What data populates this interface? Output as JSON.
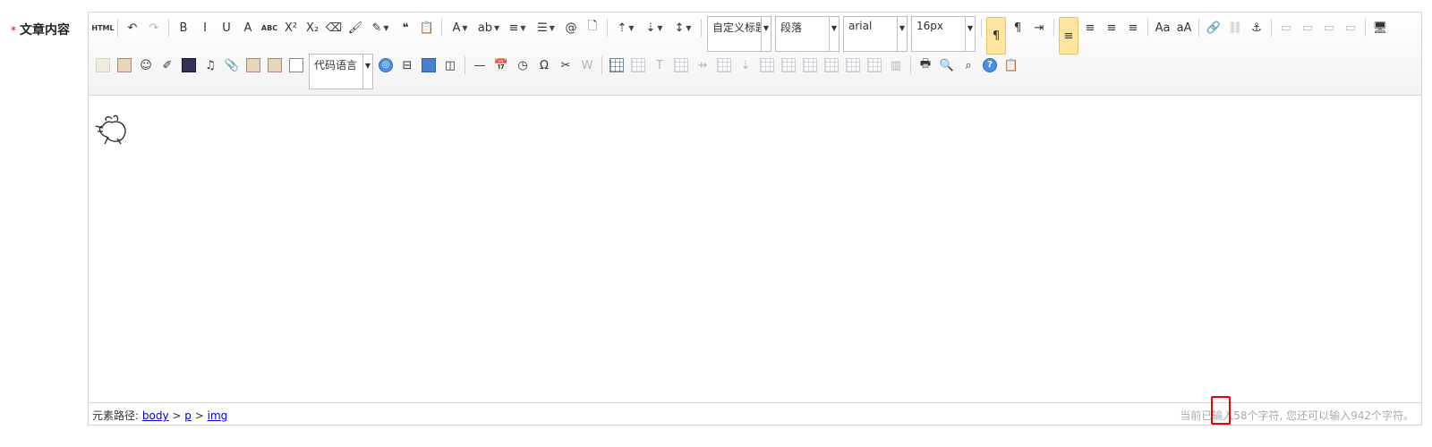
{
  "field": {
    "required_mark": "*",
    "label": "文章内容"
  },
  "toolbar": {
    "row1": [
      {
        "name": "html-source-button",
        "glyph": "HTML"
      },
      {
        "sep": true
      },
      {
        "name": "undo-button",
        "glyph": "↶"
      },
      {
        "name": "redo-button",
        "glyph": "↷",
        "disabled": true
      },
      {
        "sep": true
      },
      {
        "name": "bold-button",
        "glyph": "B"
      },
      {
        "name": "italic-button",
        "glyph": "I"
      },
      {
        "name": "underline-button",
        "glyph": "U"
      },
      {
        "name": "font-border-button",
        "glyph": "A"
      },
      {
        "name": "strikethrough-button",
        "glyph": "ABC"
      },
      {
        "name": "superscript-button",
        "glyph": "X²"
      },
      {
        "name": "subscript-button",
        "glyph": "X₂"
      },
      {
        "name": "eraser-button",
        "glyph": "⌫"
      },
      {
        "name": "format-match-button",
        "glyph": "🖌"
      },
      {
        "name": "auto-format-button",
        "glyph": "✎",
        "caret": true
      },
      {
        "name": "blockquote-button",
        "glyph": "❝"
      },
      {
        "name": "paste-plain-button",
        "glyph": "📋"
      },
      {
        "sep": true
      },
      {
        "name": "font-color-button",
        "glyph": "A",
        "caret": true
      },
      {
        "name": "back-color-button",
        "glyph": "ab",
        "caret": true
      },
      {
        "name": "ordered-list-button",
        "glyph": "≡",
        "caret": true
      },
      {
        "name": "unordered-list-button",
        "glyph": "☰",
        "caret": true
      },
      {
        "name": "select-all-button",
        "glyph": "@"
      },
      {
        "name": "clear-doc-button",
        "glyph": "🗋"
      },
      {
        "sep": true
      },
      {
        "name": "row-spacing-top-button",
        "glyph": "⇡",
        "caret": true
      },
      {
        "name": "row-spacing-bottom-button",
        "glyph": "⇣",
        "caret": true
      },
      {
        "name": "line-height-button",
        "glyph": "↕",
        "caret": true
      },
      {
        "sep": true
      },
      {
        "combo": true,
        "name": "custom-style-select",
        "value": "自定义标题",
        "width": 72
      },
      {
        "combo": true,
        "name": "paragraph-select",
        "value": "段落",
        "width": 72
      },
      {
        "combo": true,
        "name": "font-family-select",
        "value": "arial",
        "width": 72
      },
      {
        "combo": true,
        "name": "font-size-select",
        "value": "16px",
        "width": 72
      },
      {
        "sep": true
      },
      {
        "name": "direction-ltr-button",
        "glyph": "¶",
        "active": true
      },
      {
        "name": "direction-rtl-button",
        "glyph": "¶"
      },
      {
        "name": "indent-button",
        "glyph": "⇥"
      },
      {
        "sep": true
      },
      {
        "name": "justify-left-button",
        "glyph": "≡",
        "active": true
      },
      {
        "name": "justify-center-button",
        "glyph": "≡"
      },
      {
        "name": "justify-right-button",
        "glyph": "≡"
      },
      {
        "name": "justify-full-button",
        "glyph": "≡"
      },
      {
        "sep": true
      },
      {
        "name": "to-uppercase-button",
        "glyph": "Aa"
      },
      {
        "name": "to-lowercase-button",
        "glyph": "aA"
      },
      {
        "sep": true
      },
      {
        "name": "link-button",
        "glyph": "🔗"
      },
      {
        "name": "unlink-button",
        "glyph": "⛓",
        "disabled": true
      },
      {
        "name": "anchor-button",
        "glyph": "⚓"
      },
      {
        "sep": true
      },
      {
        "name": "image-none-button",
        "glyph": "▭",
        "disabled": true
      },
      {
        "name": "image-left-button",
        "glyph": "▭",
        "disabled": true
      },
      {
        "name": "image-right-button",
        "glyph": "▭",
        "disabled": true
      },
      {
        "name": "image-center-button",
        "glyph": "▭",
        "disabled": true
      },
      {
        "sep": true
      },
      {
        "name": "preview-button",
        "glyph": "🖥"
      }
    ],
    "row2": [
      {
        "name": "simple-upload-button",
        "icon": "img",
        "disabled": true
      },
      {
        "name": "insert-image-button",
        "icon": "img"
      },
      {
        "name": "emotion-button",
        "glyph": "☺"
      },
      {
        "name": "scrawl-button",
        "glyph": "✐"
      },
      {
        "name": "insert-video-button",
        "icon": "film"
      },
      {
        "name": "music-button",
        "glyph": "♫"
      },
      {
        "name": "attachment-button",
        "glyph": "📎"
      },
      {
        "name": "map-button",
        "icon": "img"
      },
      {
        "name": "gmap-button",
        "icon": "img"
      },
      {
        "name": "insert-frame-button",
        "icon": "doc"
      },
      {
        "combo": true,
        "name": "code-language-select",
        "value": "代码语言",
        "width": 72
      },
      {
        "name": "webapp-button",
        "icon": "round",
        "glyph": "◎"
      },
      {
        "name": "page-break-button",
        "glyph": "⊟"
      },
      {
        "name": "template-button",
        "icon": "blue"
      },
      {
        "name": "background-button",
        "glyph": "◫"
      },
      {
        "sep": true
      },
      {
        "name": "horizontal-rule-button",
        "glyph": "—"
      },
      {
        "name": "date-button",
        "glyph": "📅"
      },
      {
        "name": "time-button",
        "glyph": "◷"
      },
      {
        "name": "special-chars-button",
        "glyph": "Ω"
      },
      {
        "name": "snapscreen-button",
        "glyph": "✂"
      },
      {
        "name": "word-image-button",
        "glyph": "W",
        "disabled": true
      },
      {
        "sep": true
      },
      {
        "name": "insert-table-button",
        "icon": "grid"
      },
      {
        "name": "delete-table-button",
        "icon": "grid",
        "disabled": true
      },
      {
        "name": "insert-paragraph-before-table-button",
        "glyph": "T",
        "disabled": true
      },
      {
        "name": "insert-row-button",
        "icon": "grid",
        "disabled": true
      },
      {
        "name": "delete-row-button",
        "glyph": "⇸",
        "disabled": true
      },
      {
        "name": "insert-col-button",
        "icon": "grid",
        "disabled": true
      },
      {
        "name": "delete-col-button",
        "glyph": "⇣",
        "disabled": true
      },
      {
        "name": "merge-cells-button",
        "icon": "grid",
        "disabled": true
      },
      {
        "name": "merge-right-button",
        "icon": "grid",
        "disabled": true
      },
      {
        "name": "merge-down-button",
        "icon": "grid",
        "disabled": true
      },
      {
        "name": "split-to-cells-button",
        "icon": "grid",
        "disabled": true
      },
      {
        "name": "split-to-rows-button",
        "icon": "grid",
        "disabled": true
      },
      {
        "name": "split-to-cols-button",
        "icon": "grid",
        "disabled": true
      },
      {
        "name": "chart-button",
        "glyph": "▥",
        "disabled": true
      },
      {
        "sep": true
      },
      {
        "name": "print-button",
        "glyph": "🖶"
      },
      {
        "name": "search-replace-button",
        "glyph": "🔍"
      },
      {
        "name": "find-button",
        "glyph": "⌕"
      },
      {
        "name": "help-button",
        "icon": "round",
        "glyph": "?"
      },
      {
        "name": "drafts-button",
        "glyph": "📋"
      }
    ]
  },
  "statusbar": {
    "path_label": "元素路径:",
    "path_items": [
      "body",
      "p",
      "img"
    ],
    "path_sep": ">",
    "word_count": "当前已输入58个字符, 您还可以输入942个字符。"
  }
}
